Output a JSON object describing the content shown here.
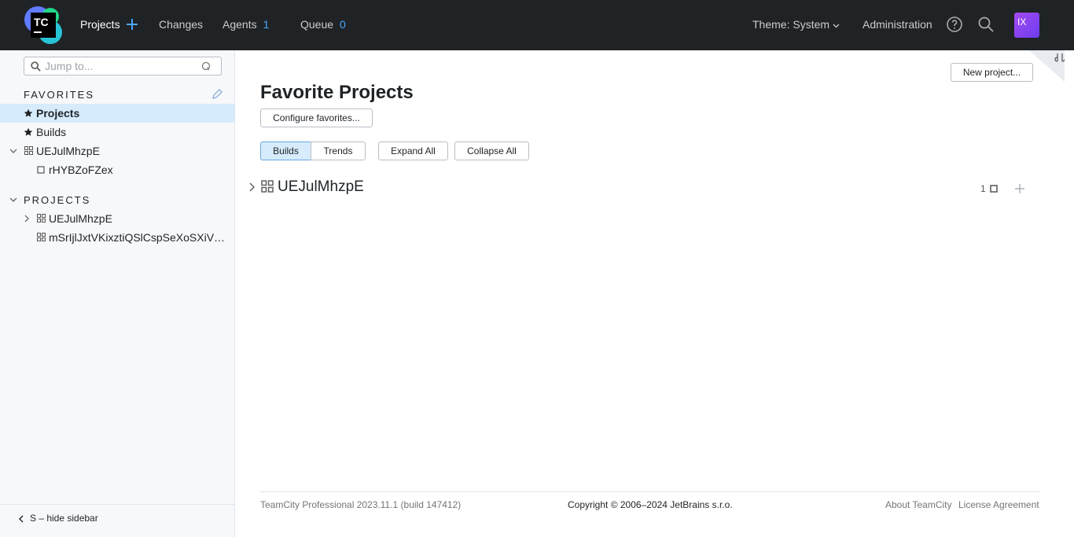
{
  "header": {
    "nav": {
      "projects": "Projects",
      "changes": "Changes",
      "agents": "Agents",
      "agents_count": "1",
      "queue": "Queue",
      "queue_count": "0",
      "theme": "Theme: System",
      "administration": "Administration"
    },
    "avatar_initials": "IX",
    "logo_text": "TC"
  },
  "sidebar": {
    "search_placeholder": "Jump to...",
    "favorites_title": "FAVORITES",
    "favorites": [
      {
        "label": "Projects"
      },
      {
        "label": "Builds"
      },
      {
        "label": "UEJulMhzpE"
      },
      {
        "label": "rHYBZoFZex"
      }
    ],
    "projects_title": "PROJECTS",
    "projects": [
      {
        "label": "UEJulMhzpE"
      },
      {
        "label": "mSrIjlJxtVKixztiQSlCspSeXoSXiV…"
      }
    ],
    "hide_label": "S – hide sidebar"
  },
  "main": {
    "new_project": "New project...",
    "title": "Favorite Projects",
    "configure": "Configure favorites...",
    "tabs": [
      {
        "label": "Builds"
      },
      {
        "label": "Trends"
      }
    ],
    "expand_all": "Expand All",
    "collapse_all": "Collapse All",
    "project_row": {
      "name": "UEJulMhzpE",
      "count": "1"
    }
  },
  "footer": {
    "version": "TeamCity Professional 2023.11.1 (build 147412)",
    "copyright": "Copyright © 2006–2024 JetBrains s.r.o.",
    "about": "About TeamCity",
    "license": "License Agreement"
  },
  "colors": {
    "header_bg": "#1f2326",
    "accent": "#4aa7ff",
    "selected_bg": "#d6ebfc",
    "sidebar_bg": "#f7f8fa"
  }
}
